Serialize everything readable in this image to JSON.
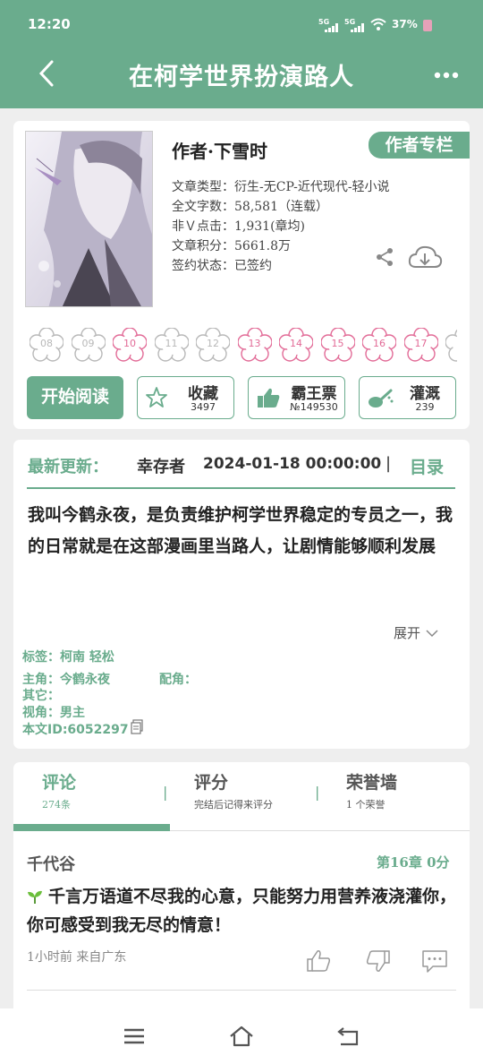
{
  "status": {
    "time": "12:20",
    "sig1": "5G",
    "sig2": "5G",
    "battery": "37%"
  },
  "header": {
    "title": "在柯学世界扮演路人"
  },
  "book": {
    "author_line": "作者·下雪时",
    "author_tag": "作者专栏",
    "info": [
      "文章类型：衍生-无CP-近代现代-轻小说",
      "全文字数：58,581（连载）",
      "非Ｖ点击：1,931(章均)",
      "文章积分：5661.8万",
      "签约状态：已签约"
    ],
    "flowers": [
      {
        "num": "08",
        "active": false
      },
      {
        "num": "09",
        "active": false
      },
      {
        "num": "10",
        "active": true
      },
      {
        "num": "11",
        "active": false
      },
      {
        "num": "12",
        "active": false
      },
      {
        "num": "13",
        "active": true
      },
      {
        "num": "14",
        "active": true
      },
      {
        "num": "15",
        "active": true
      },
      {
        "num": "16",
        "active": true
      },
      {
        "num": "17",
        "active": true
      }
    ],
    "flower_colors": {
      "active": "#e26b97",
      "inactive": "#b8b8b8"
    },
    "actions": {
      "read": "开始阅读",
      "fav_label": "收藏",
      "fav_count": "3497",
      "ticket_label": "霸王票",
      "ticket_count": "№149530",
      "water_label": "灌溉",
      "water_count": "239"
    }
  },
  "update": {
    "label": "最新更新：",
    "chapter": "幸存者",
    "date": "2024-01-18 00:00:00",
    "separator": "|",
    "toc": "目录",
    "summary": "我叫今鹤永夜，是负责维护柯学世界稳定的专员之一，我的日常就是在这部漫画里当路人，让剧情能够顺利发展",
    "expand": "展开",
    "tags": "标签：柯南 轻松",
    "lead": "主角：今鹤永夜",
    "support": "配角：",
    "other": "其它：",
    "pov": "视角：男主",
    "id": "本文ID:6052297"
  },
  "comments": {
    "tabs": [
      {
        "title": "评论",
        "sub": "274条"
      },
      {
        "title": "评分",
        "sub": "完结后记得来评分"
      },
      {
        "title": "荣誉墙",
        "sub": "1 个荣誉"
      }
    ],
    "divider": "|",
    "item": {
      "user": "千代谷",
      "chapter": "第16章  0分",
      "text": "千言万语道不尽我的心意，只能努力用营养液浇灌你，你可感受到我无尽的情意！",
      "time": "1小时前  来自广东"
    }
  },
  "colors": {
    "accent": "#6aac8d",
    "pink": "#e26b97"
  }
}
